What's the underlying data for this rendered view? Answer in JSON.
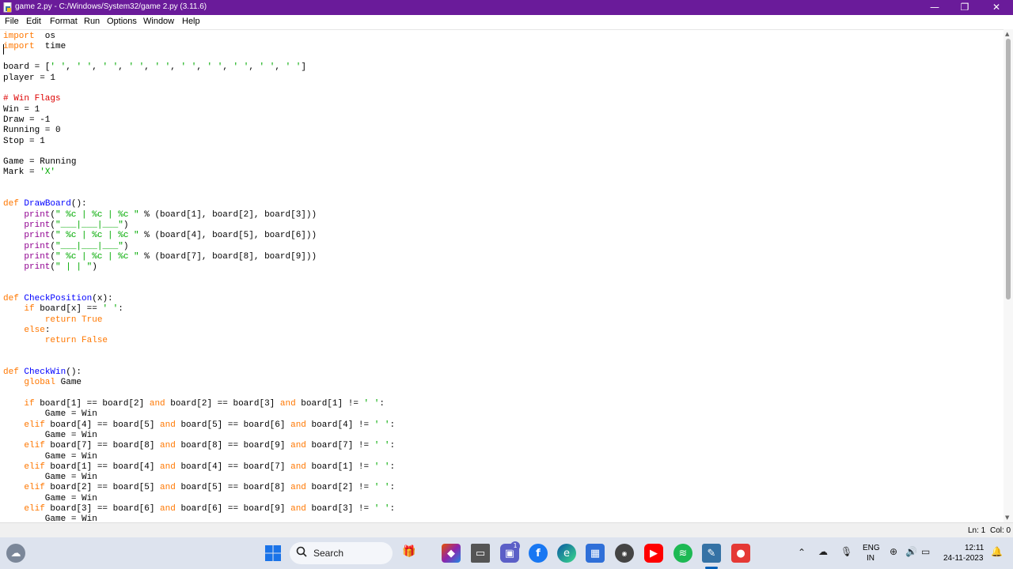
{
  "window": {
    "title": "game 2.py - C:/Windows/System32/game 2.py (3.11.6)",
    "minimize_glyph": "—",
    "maximize_glyph": "❐",
    "close_glyph": "✕"
  },
  "menu": [
    "File",
    "Edit",
    "Format",
    "Run",
    "Options",
    "Window",
    "Help"
  ],
  "code_lines": [
    [
      [
        "kw",
        "import"
      ],
      [
        "",
        "  os"
      ]
    ],
    [
      [
        "kw",
        "import"
      ],
      [
        "",
        "  time"
      ]
    ],
    [],
    [
      [
        "",
        "board = ["
      ],
      [
        "str",
        "' '"
      ],
      [
        "",
        ", "
      ],
      [
        "str",
        "' '"
      ],
      [
        "",
        ", "
      ],
      [
        "str",
        "' '"
      ],
      [
        "",
        ", "
      ],
      [
        "str",
        "' '"
      ],
      [
        "",
        ", "
      ],
      [
        "str",
        "' '"
      ],
      [
        "",
        ", "
      ],
      [
        "str",
        "' '"
      ],
      [
        "",
        ", "
      ],
      [
        "str",
        "' '"
      ],
      [
        "",
        ", "
      ],
      [
        "str",
        "' '"
      ],
      [
        "",
        ", "
      ],
      [
        "str",
        "' '"
      ],
      [
        "",
        ", "
      ],
      [
        "str",
        "' '"
      ],
      [
        "",
        "]"
      ]
    ],
    [
      [
        "",
        "player = 1"
      ]
    ],
    [],
    [
      [
        "cmt",
        "# Win Flags"
      ]
    ],
    [
      [
        "",
        "Win = 1"
      ]
    ],
    [
      [
        "",
        "Draw = -1"
      ]
    ],
    [
      [
        "",
        "Running = 0"
      ]
    ],
    [
      [
        "",
        "Stop = 1"
      ]
    ],
    [],
    [
      [
        "",
        "Game = Running"
      ]
    ],
    [
      [
        "",
        "Mark = "
      ],
      [
        "str",
        "'X'"
      ]
    ],
    [],
    [],
    [
      [
        "kw",
        "def"
      ],
      [
        "",
        " "
      ],
      [
        "def",
        "DrawBoard"
      ],
      [
        "",
        "():"
      ]
    ],
    [
      [
        "",
        "    "
      ],
      [
        "bi",
        "print"
      ],
      [
        "",
        "("
      ],
      [
        "str",
        "\" %c | %c | %c \""
      ],
      [
        "",
        " % (board[1], board[2], board[3]))"
      ]
    ],
    [
      [
        "",
        "    "
      ],
      [
        "bi",
        "print"
      ],
      [
        "",
        "("
      ],
      [
        "str",
        "\"___|___|___\""
      ],
      [
        "",
        ")"
      ]
    ],
    [
      [
        "",
        "    "
      ],
      [
        "bi",
        "print"
      ],
      [
        "",
        "("
      ],
      [
        "str",
        "\" %c | %c | %c \""
      ],
      [
        "",
        " % (board[4], board[5], board[6]))"
      ]
    ],
    [
      [
        "",
        "    "
      ],
      [
        "bi",
        "print"
      ],
      [
        "",
        "("
      ],
      [
        "str",
        "\"___|___|___\""
      ],
      [
        "",
        ")"
      ]
    ],
    [
      [
        "",
        "    "
      ],
      [
        "bi",
        "print"
      ],
      [
        "",
        "("
      ],
      [
        "str",
        "\" %c | %c | %c \""
      ],
      [
        "",
        " % (board[7], board[8], board[9]))"
      ]
    ],
    [
      [
        "",
        "    "
      ],
      [
        "bi",
        "print"
      ],
      [
        "",
        "("
      ],
      [
        "str",
        "\" | | \""
      ],
      [
        "",
        ")"
      ]
    ],
    [],
    [],
    [
      [
        "kw",
        "def"
      ],
      [
        "",
        " "
      ],
      [
        "def",
        "CheckPosition"
      ],
      [
        "",
        "(x):"
      ]
    ],
    [
      [
        "",
        "    "
      ],
      [
        "kw",
        "if"
      ],
      [
        "",
        " board[x] == "
      ],
      [
        "str",
        "' '"
      ],
      [
        "",
        ":"
      ]
    ],
    [
      [
        "",
        "        "
      ],
      [
        "kw",
        "return True"
      ]
    ],
    [
      [
        "",
        "    "
      ],
      [
        "kw",
        "else"
      ],
      [
        "",
        ":"
      ]
    ],
    [
      [
        "",
        "        "
      ],
      [
        "kw",
        "return False"
      ]
    ],
    [],
    [],
    [
      [
        "kw",
        "def"
      ],
      [
        "",
        " "
      ],
      [
        "def",
        "CheckWin"
      ],
      [
        "",
        "():"
      ]
    ],
    [
      [
        "",
        "    "
      ],
      [
        "kw",
        "global"
      ],
      [
        "",
        " Game"
      ]
    ],
    [],
    [
      [
        "",
        "    "
      ],
      [
        "kw",
        "if"
      ],
      [
        "",
        " board[1] == board[2] "
      ],
      [
        "kw",
        "and"
      ],
      [
        "",
        " board[2] == board[3] "
      ],
      [
        "kw",
        "and"
      ],
      [
        "",
        " board[1] != "
      ],
      [
        "str",
        "' '"
      ],
      [
        "",
        ":"
      ]
    ],
    [
      [
        "",
        "        Game = Win"
      ]
    ],
    [
      [
        "",
        "    "
      ],
      [
        "kw",
        "elif"
      ],
      [
        "",
        " board[4] == board[5] "
      ],
      [
        "kw",
        "and"
      ],
      [
        "",
        " board[5] == board[6] "
      ],
      [
        "kw",
        "and"
      ],
      [
        "",
        " board[4] != "
      ],
      [
        "str",
        "' '"
      ],
      [
        "",
        ":"
      ]
    ],
    [
      [
        "",
        "        Game = Win"
      ]
    ],
    [
      [
        "",
        "    "
      ],
      [
        "kw",
        "elif"
      ],
      [
        "",
        " board[7] == board[8] "
      ],
      [
        "kw",
        "and"
      ],
      [
        "",
        " board[8] == board[9] "
      ],
      [
        "kw",
        "and"
      ],
      [
        "",
        " board[7] != "
      ],
      [
        "str",
        "' '"
      ],
      [
        "",
        ":"
      ]
    ],
    [
      [
        "",
        "        Game = Win"
      ]
    ],
    [
      [
        "",
        "    "
      ],
      [
        "kw",
        "elif"
      ],
      [
        "",
        " board[1] == board[4] "
      ],
      [
        "kw",
        "and"
      ],
      [
        "",
        " board[4] == board[7] "
      ],
      [
        "kw",
        "and"
      ],
      [
        "",
        " board[1] != "
      ],
      [
        "str",
        "' '"
      ],
      [
        "",
        ":"
      ]
    ],
    [
      [
        "",
        "        Game = Win"
      ]
    ],
    [
      [
        "",
        "    "
      ],
      [
        "kw",
        "elif"
      ],
      [
        "",
        " board[2] == board[5] "
      ],
      [
        "kw",
        "and"
      ],
      [
        "",
        " board[5] == board[8] "
      ],
      [
        "kw",
        "and"
      ],
      [
        "",
        " board[2] != "
      ],
      [
        "str",
        "' '"
      ],
      [
        "",
        ":"
      ]
    ],
    [
      [
        "",
        "        Game = Win"
      ]
    ],
    [
      [
        "",
        "    "
      ],
      [
        "kw",
        "elif"
      ],
      [
        "",
        " board[3] == board[6] "
      ],
      [
        "kw",
        "and"
      ],
      [
        "",
        " board[6] == board[9] "
      ],
      [
        "kw",
        "and"
      ],
      [
        "",
        " board[3] != "
      ],
      [
        "str",
        "' '"
      ],
      [
        "",
        ":"
      ]
    ],
    [
      [
        "",
        "        Game = Win"
      ]
    ]
  ],
  "status": {
    "line": "Ln: 1",
    "col": "Col: 0"
  },
  "taskbar": {
    "search_label": "Search",
    "badge_count": "1",
    "lang_top": "ENG",
    "lang_bottom": "IN",
    "time": "12:11",
    "date": "24-11-2023"
  },
  "colors": {
    "titlebar": "#6a1b9a",
    "keyword": "#ff7700",
    "string": "#00aa00",
    "comment": "#dd0000",
    "definition": "#0000ff",
    "builtin": "#900090"
  }
}
